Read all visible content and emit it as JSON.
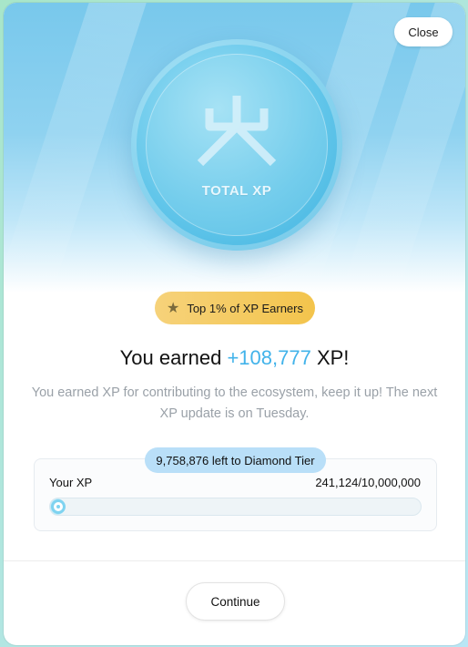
{
  "header": {
    "close_label": "Close"
  },
  "coin": {
    "label": "TOTAL XP",
    "icon": "logo-icon"
  },
  "badge": {
    "label": "Top 1% of XP Earners",
    "icon": "star-icon"
  },
  "headline": {
    "prefix": "You earned ",
    "amount": "+108,777",
    "suffix": " XP!"
  },
  "description": "You earned XP for contributing to the ecosystem, keep it up! The next XP update is on Tuesday.",
  "xp": {
    "tag": "9,758,876 left to Diamond Tier",
    "label": "Your XP",
    "value": "241,124/10,000,000",
    "progress_percent": 2.4
  },
  "footer": {
    "continue_label": "Continue"
  },
  "colors": {
    "accent": "#42b3ea",
    "badge": "#f3c44c",
    "tag": "#b9dff8"
  }
}
